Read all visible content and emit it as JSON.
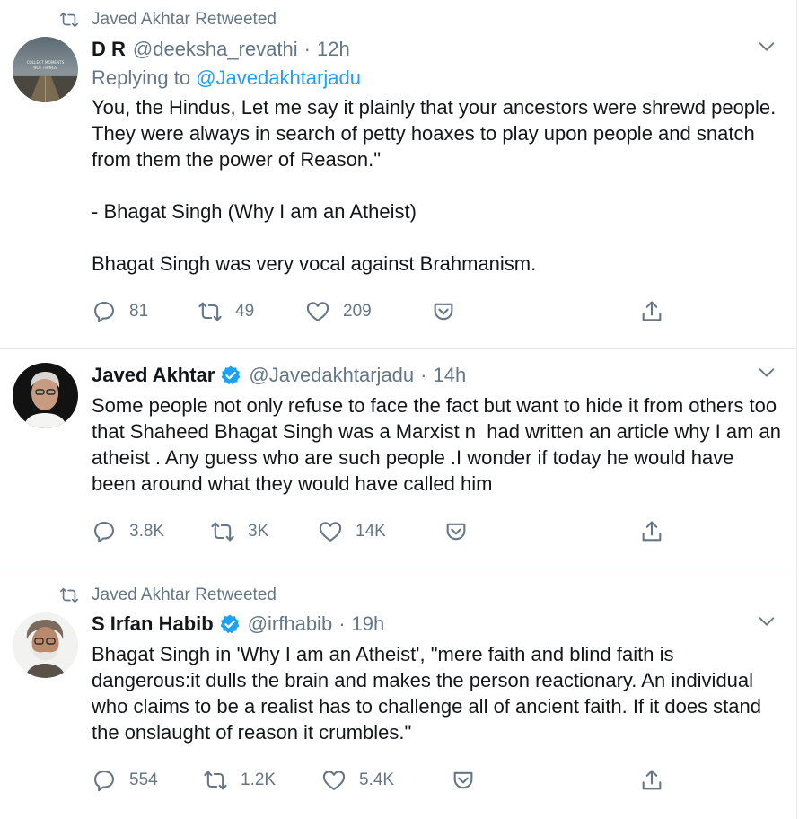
{
  "tweets": [
    {
      "retweeted_by": "Javed Akhtar Retweeted",
      "name": "D R",
      "verified": false,
      "handle": "@deeksha_revathi",
      "time": "12h",
      "replying_label": "Replying to ",
      "replying_to": "@Javedakhtarjadu",
      "text": "You, the Hindus, Let me say it plainly that your ancestors were shrewd people. They were always in search of petty hoaxes to play upon people and snatch from them the power of Reason.\"\n\n- Bhagat Singh (Why I am an Atheist)\n\nBhagat Singh was very vocal against Brahmanism.",
      "avatar_text": "COLLECT MOMENTS NOT THINGS",
      "replies": "81",
      "retweets": "49",
      "likes": "209"
    },
    {
      "name": "Javed Akhtar",
      "verified": true,
      "handle": "@Javedakhtarjadu",
      "time": "14h",
      "text": "Some people not only refuse to face the fact but want to hide it from others too that Shaheed Bhagat Singh was a Marxist n  had written an article why I am an atheist . Any guess who are such people .I wonder if today he would have been around what they would have called him",
      "replies": "3.8K",
      "retweets": "3K",
      "likes": "14K"
    },
    {
      "retweeted_by": "Javed Akhtar Retweeted",
      "name": "S Irfan Habib",
      "verified": true,
      "handle": "@irfhabib",
      "time": "19h",
      "text": "Bhagat Singh in 'Why I am an Atheist', \"mere faith and blind faith is dangerous:it dulls the brain and makes the person reactionary. An individual who claims to be a realist has to challenge all of ancient faith. If it does stand the onslaught of reason it crumbles.\"",
      "replies": "554",
      "retweets": "1.2K",
      "likes": "5.4K"
    }
  ],
  "icons": {
    "retweet": "retweet-icon",
    "reply": "reply-icon",
    "like": "heart-icon",
    "save": "pocket-save-icon",
    "share": "share-icon",
    "more": "chevron-down-icon",
    "verified": "verified-badge-icon"
  },
  "colors": {
    "accent": "#1da1f2",
    "muted": "#657786",
    "text": "#14171a"
  }
}
